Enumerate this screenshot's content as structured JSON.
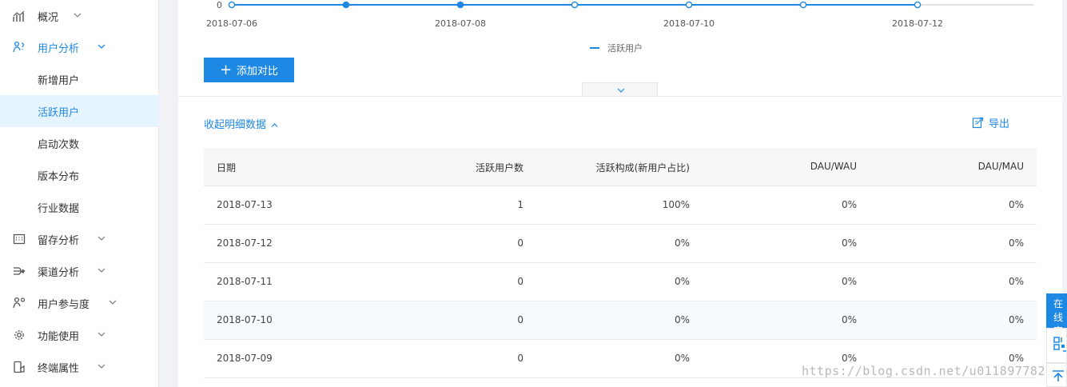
{
  "sidebar": {
    "items": [
      {
        "label": "概况",
        "icon": "line-chart-icon",
        "chevron": true
      },
      {
        "label": "用户分析",
        "icon": "users-icon",
        "chevron": true,
        "expanded": true
      },
      {
        "label": "新增用户",
        "sub": true
      },
      {
        "label": "活跃用户",
        "sub": true,
        "active": true
      },
      {
        "label": "启动次数",
        "sub": true
      },
      {
        "label": "版本分布",
        "sub": true
      },
      {
        "label": "行业数据",
        "sub": true
      },
      {
        "label": "留存分析",
        "icon": "grid-calendar-icon",
        "chevron": true
      },
      {
        "label": "渠道分析",
        "icon": "channel-icon",
        "chevron": true
      },
      {
        "label": "用户参与度",
        "icon": "user-engage-icon",
        "chevron": true
      },
      {
        "label": "功能使用",
        "icon": "gear-icon",
        "chevron": true
      },
      {
        "label": "终端属性",
        "icon": "device-icon",
        "chevron": true
      }
    ]
  },
  "chart": {
    "y_zero_label": "0",
    "x_labels": [
      "2018-07-06",
      "2018-07-08",
      "2018-07-10",
      "2018-07-12"
    ],
    "legend": "活跃用户",
    "accent": "#1e88e5"
  },
  "chart_data": {
    "type": "line",
    "x": [
      "2018-07-06",
      "2018-07-07",
      "2018-07-08",
      "2018-07-09",
      "2018-07-10",
      "2018-07-11",
      "2018-07-12"
    ],
    "series": [
      {
        "name": "活跃用户",
        "values": [
          0,
          0,
          0,
          0,
          0,
          0,
          0
        ]
      }
    ],
    "xlabel": "",
    "ylabel": ""
  },
  "actions": {
    "add_compare": "添加对比",
    "collapse_detail": "收起明细数据",
    "export": "导出"
  },
  "table": {
    "headers": [
      "日期",
      "活跃用户数",
      "活跃构成(新用户占比)",
      "DAU/WAU",
      "DAU/MAU"
    ],
    "rows": [
      [
        "2018-07-13",
        "1",
        "100%",
        "0%",
        "0%"
      ],
      [
        "2018-07-12",
        "0",
        "0%",
        "0%",
        "0%"
      ],
      [
        "2018-07-11",
        "0",
        "0%",
        "0%",
        "0%"
      ],
      [
        "2018-07-10",
        "0",
        "0%",
        "0%",
        "0%"
      ],
      [
        "2018-07-09",
        "0",
        "0%",
        "0%",
        "0%"
      ]
    ]
  },
  "float_widget": {
    "service_text": "在线客服"
  },
  "watermark": "https://blog.csdn.net/u011897782"
}
